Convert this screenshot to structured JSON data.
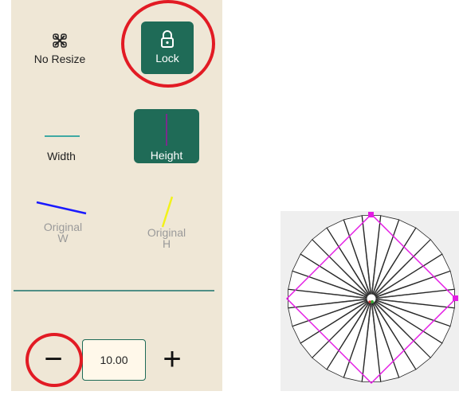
{
  "resize_modes": {
    "no_resize": {
      "label": "No Resize",
      "icon": "no-resize-icon"
    },
    "lock": {
      "label": "Lock",
      "icon": "lock-icon",
      "active": true
    }
  },
  "fit": {
    "width": {
      "label": "Width",
      "line_color": "#3fa9a3"
    },
    "height": {
      "label": "Height",
      "line_color": "#7a2c8c",
      "active": true
    }
  },
  "original": {
    "w": {
      "label": "Original\nW",
      "line_color": "#1a1aff"
    },
    "h": {
      "label": "Original\nH",
      "line_color": "#f2f21a"
    }
  },
  "stepper": {
    "value": "10.00",
    "minus": "−",
    "plus": "+"
  },
  "colors": {
    "accent": "#1f6b57",
    "panel": "#efe7d6",
    "annotation": "#e21b24",
    "diamond": "#e31ce3"
  }
}
